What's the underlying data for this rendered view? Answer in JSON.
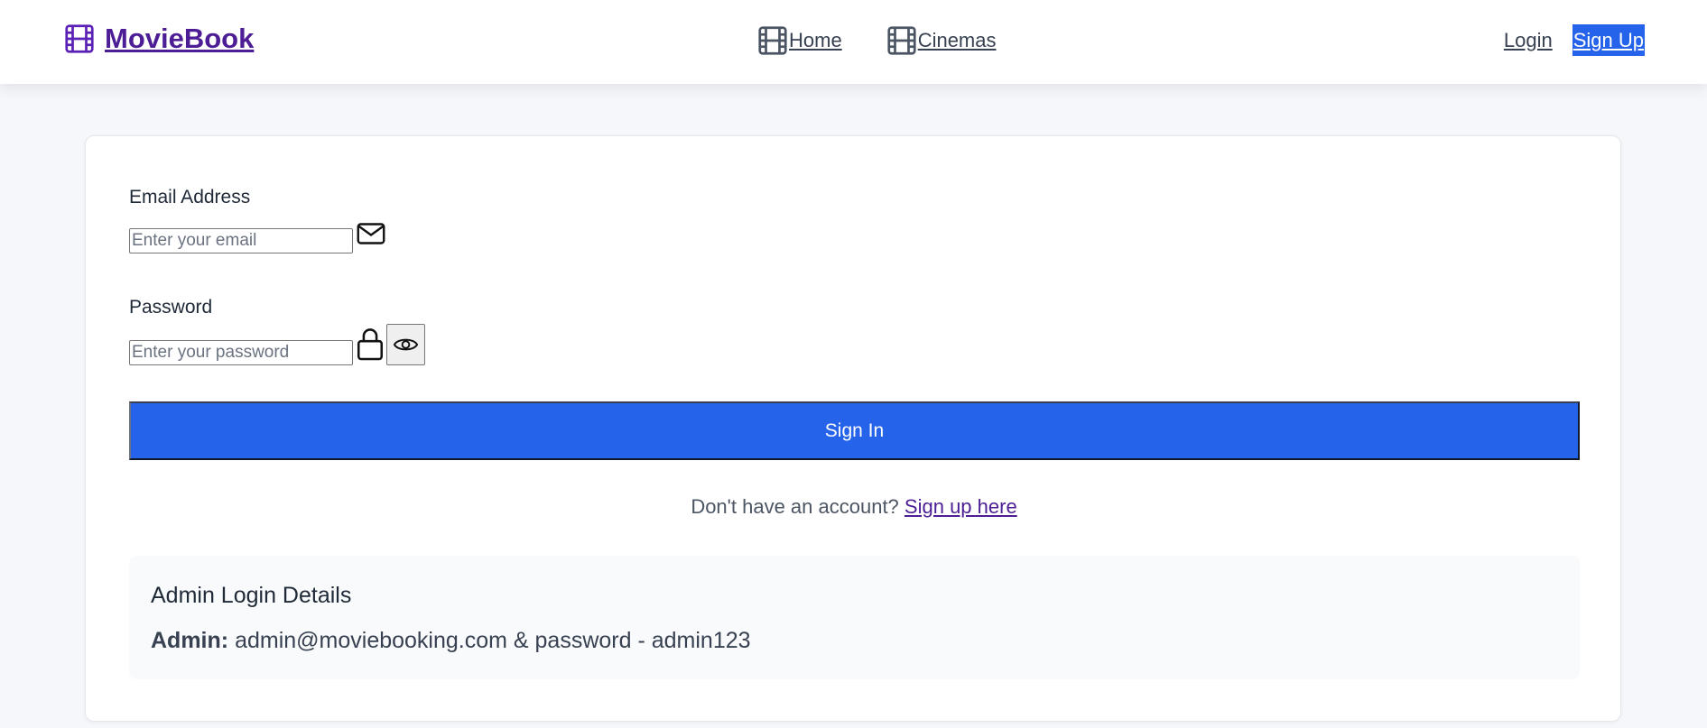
{
  "nav": {
    "brand": "MovieBook",
    "links": [
      "Home",
      "Cinemas"
    ],
    "login": "Login",
    "signup": "Sign Up"
  },
  "form": {
    "email_label": "Email Address",
    "email_placeholder": "Enter your email",
    "email_value": "",
    "password_label": "Password",
    "password_placeholder": "Enter your password",
    "password_value": "",
    "submit": "Sign In",
    "prompt": "Don't have an account?",
    "prompt_link": "Sign up here"
  },
  "admin": {
    "title": "Admin Login Details",
    "label": "Admin:",
    "details": "admin@moviebooking.com & password - admin123"
  },
  "icons": {
    "brand": "film-icon",
    "home": "film-icon",
    "cinemas": "film-icon",
    "email": "mail-icon",
    "password": "lock-icon",
    "toggle": "eye-icon"
  },
  "colors": {
    "brand": "#4c1d95",
    "primary": "#2563eb"
  }
}
